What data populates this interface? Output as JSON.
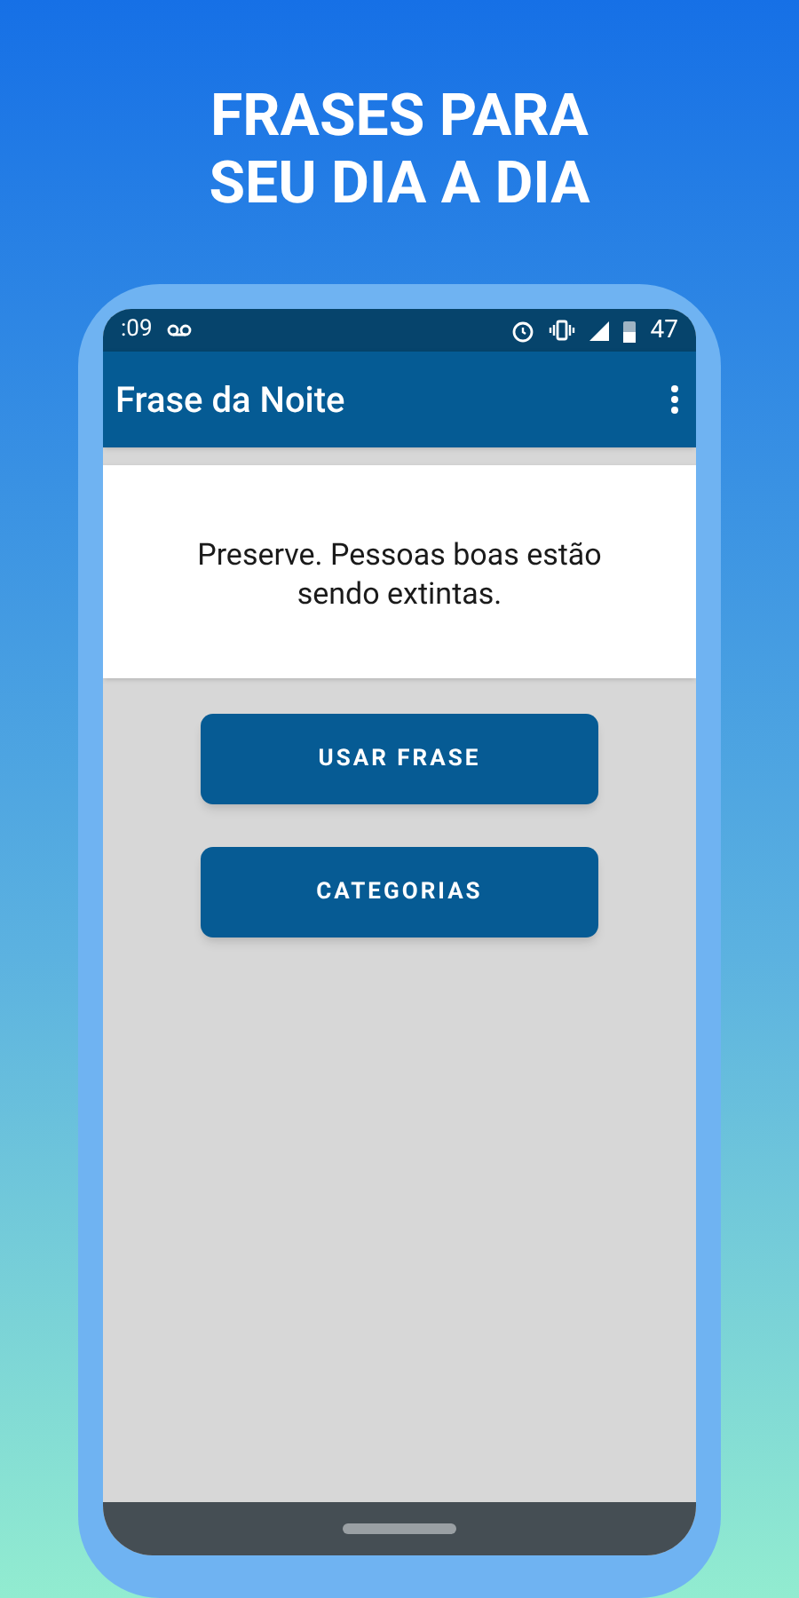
{
  "headline": [
    "FRASES PARA",
    "SEU DIA A DIA"
  ],
  "status_bar": {
    "time": ":09",
    "battery": "47"
  },
  "app_bar": {
    "title": "Frase da Noite"
  },
  "quote": "Preserve. Pessoas boas estão sendo extintas.",
  "buttons": [
    "USAR FRASE",
    "CATEGORIAS"
  ]
}
